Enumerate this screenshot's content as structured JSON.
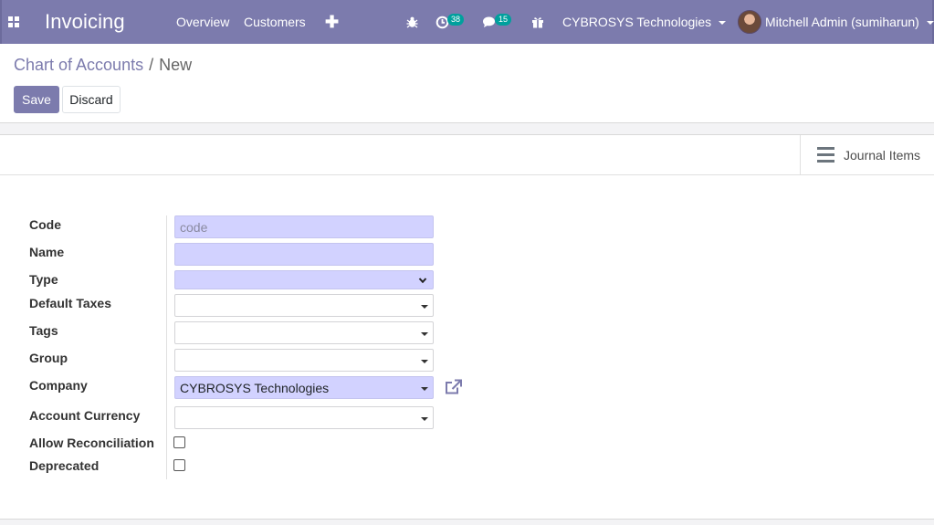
{
  "navbar": {
    "brand": "Invoicing",
    "menu": [
      "Overview",
      "Customers"
    ],
    "add_symbol": "✚",
    "activity_count": "38",
    "message_count": "15",
    "company": "CYBROSYS Technologies",
    "user": "Mitchell Admin (sumiharun)",
    "icons": [
      "apps-grid-icon",
      "bug-icon",
      "activity-clock-icon",
      "chat-icon",
      "gift-icon",
      "avatar"
    ],
    "color": "#7c7bad"
  },
  "breadcrumb": {
    "parent": "Chart of Accounts",
    "separator": "/",
    "current": "New"
  },
  "actions": {
    "save": "Save",
    "discard": "Discard"
  },
  "smart_button": {
    "label": "Journal Items",
    "icon": "list-icon"
  },
  "form": {
    "code": {
      "label": "Code",
      "placeholder": "code",
      "value": ""
    },
    "name": {
      "label": "Name",
      "value": ""
    },
    "type": {
      "label": "Type",
      "value": ""
    },
    "default_taxes": {
      "label": "Default Taxes",
      "value": ""
    },
    "tags": {
      "label": "Tags",
      "value": ""
    },
    "group": {
      "label": "Group",
      "value": ""
    },
    "company": {
      "label": "Company",
      "value": "CYBROSYS Technologies",
      "link_icon": "external-link-icon"
    },
    "account_currency": {
      "label": "Account Currency",
      "value": ""
    },
    "allow_reconciliation": {
      "label": "Allow Reconciliation",
      "checked": false
    },
    "deprecated": {
      "label": "Deprecated",
      "checked": false
    }
  }
}
